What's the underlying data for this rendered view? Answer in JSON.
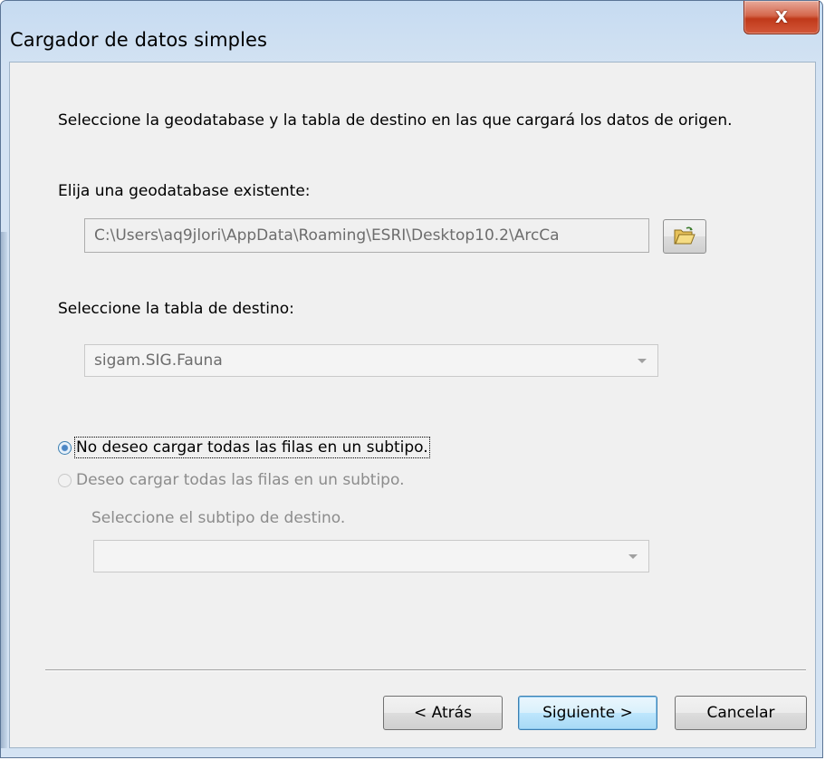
{
  "window": {
    "title": "Cargador de datos simples",
    "close_glyph": "X"
  },
  "instructions": "Seleccione la geodatabase y la tabla de destino en las que cargará los datos de origen.",
  "geodatabase": {
    "label": "Elija una geodatabase existente:",
    "path": "C:\\Users\\aq9jlori\\AppData\\Roaming\\ESRI\\Desktop10.2\\ArcCa",
    "browse_icon": "open-folder-icon"
  },
  "target_table": {
    "label": "Seleccione la tabla de destino:",
    "selected": "sigam.SIG.Fauna"
  },
  "subtype": {
    "option_no": "No deseo cargar todas las filas en un subtipo.",
    "option_yes": "Deseo cargar todas las filas en un subtipo.",
    "selected_option": "option_no",
    "label": "Seleccione el subtipo de destino.",
    "selected": ""
  },
  "buttons": {
    "back": "< Atrás",
    "next": "Siguiente >",
    "cancel": "Cancelar"
  },
  "colors": {
    "title_bar": "#c6dbf1",
    "client_bg": "#f0f0f0",
    "close_button": "#c0391a",
    "default_button_border": "#3c7fb1"
  }
}
